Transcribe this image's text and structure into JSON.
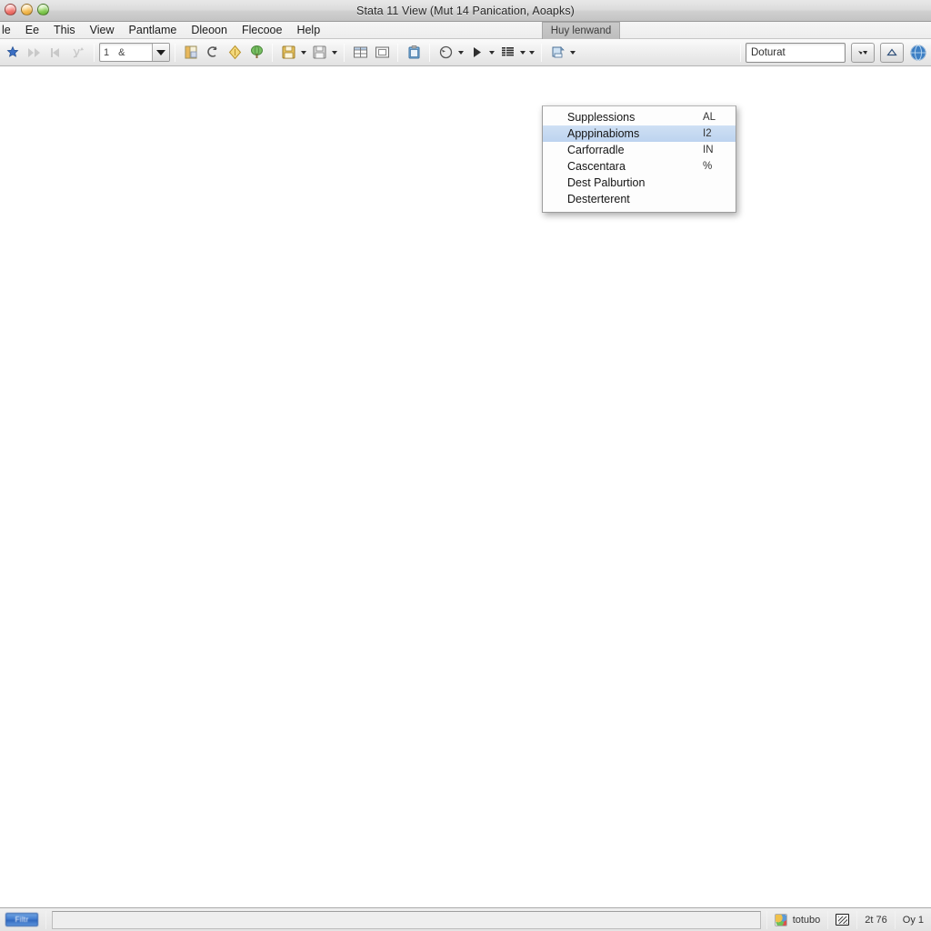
{
  "window": {
    "title": "Stata 11 View (Mut 14 Panication, Aoapks)",
    "traffic_lights": [
      {
        "name": "close",
        "color": "#f2746c"
      },
      {
        "name": "minimize",
        "color": "#f5bb52"
      },
      {
        "name": "maximize",
        "color": "#84cc52"
      }
    ]
  },
  "menubar": {
    "items": [
      {
        "label": "le"
      },
      {
        "label": "Ee"
      },
      {
        "label": "This"
      },
      {
        "label": "View"
      },
      {
        "label": "Pantlame"
      },
      {
        "label": "Dleoon"
      },
      {
        "label": "Flecooe"
      },
      {
        "label": "Help"
      }
    ],
    "open_menu_tab": "Huy lenwand"
  },
  "toolbar": {
    "combo_value": "1",
    "combo_value2": "&",
    "search_value": "Doturat",
    "buttons": [
      {
        "name": "new-star",
        "glyph": "star"
      },
      {
        "name": "fast-forward",
        "glyph": "ffwd"
      },
      {
        "name": "step-back",
        "glyph": "stepback"
      },
      {
        "name": "branch",
        "glyph": "branch"
      },
      {
        "name": "open-file",
        "glyph": "openfile"
      },
      {
        "name": "undo-arrow",
        "glyph": "undo"
      },
      {
        "name": "diamond",
        "glyph": "diamond"
      },
      {
        "name": "globe-tree",
        "glyph": "globetree"
      },
      {
        "name": "save-yellow",
        "glyph": "saveyellow"
      },
      {
        "name": "save-gray",
        "glyph": "savegray"
      },
      {
        "name": "grid-table",
        "glyph": "gridtable"
      },
      {
        "name": "single-cell",
        "glyph": "singlecell"
      },
      {
        "name": "clipboard",
        "glyph": "clipboard"
      },
      {
        "name": "rotate",
        "glyph": "rotate"
      },
      {
        "name": "play",
        "glyph": "play"
      },
      {
        "name": "list",
        "glyph": "list"
      },
      {
        "name": "print-page",
        "glyph": "printpage"
      }
    ]
  },
  "dropdown": {
    "items": [
      {
        "label": "Supplessions",
        "shortcut": "AL",
        "selected": false
      },
      {
        "label": "Apppinabioms",
        "shortcut": "I2",
        "selected": true
      },
      {
        "label": "Carforradle",
        "shortcut": "IN",
        "selected": false
      },
      {
        "label": "Cascentara",
        "shortcut": "%",
        "selected": false
      },
      {
        "label": "Dest Palburtion",
        "shortcut": "",
        "selected": false
      },
      {
        "label": "Desterterent",
        "shortcut": "",
        "selected": false
      }
    ]
  },
  "statusbar": {
    "start_label": "Filtr",
    "field_value": "",
    "app_label": "totubo",
    "counter": "2t 76",
    "page": "Oy 1"
  },
  "colors": {
    "selection_blue": "#c3d8f0",
    "titlebar_gray": "#dcdcdc",
    "toolbar_gray": "#eeeeee",
    "canvas_white": "#ffffff",
    "status_gray": "#e3e3e3"
  }
}
